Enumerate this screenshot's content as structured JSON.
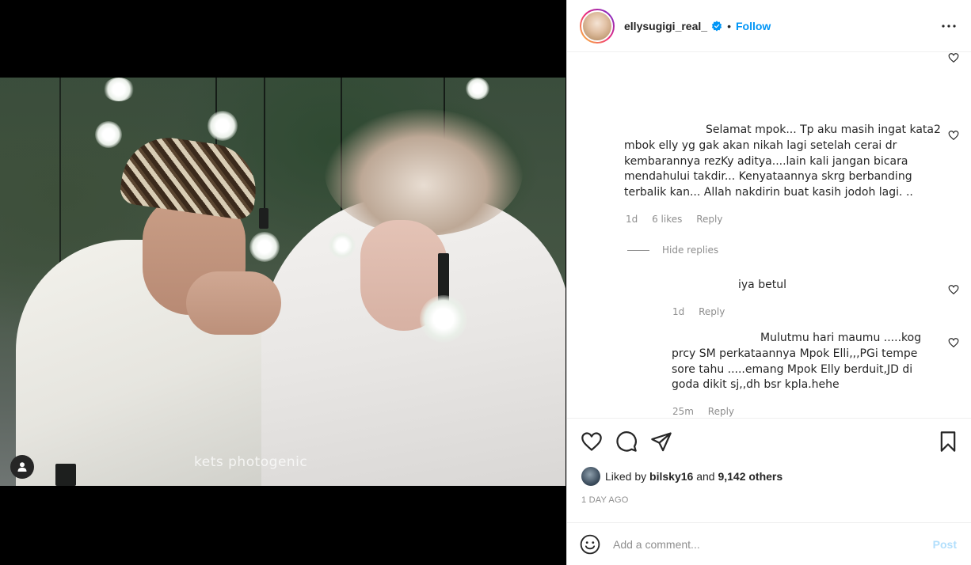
{
  "media": {
    "watermark": "kets photogenic",
    "tag_icon": "user-tag-icon"
  },
  "header": {
    "username": "ellysugigi_real_",
    "verified_icon": "verified-badge-icon",
    "separator": "•",
    "follow_label": "Follow",
    "more_icon": "more-options-icon"
  },
  "comments": [
    {
      "text_lines": [
        "Selamat mpok... Tp aku masih ingat kata2",
        "mbok elly yg gak akan nikah lagi setelah cerai dr",
        "kembarannya rezKy aditya....lain kali jangan bicara",
        "mendahului takdir... Kenyataannya skrg berbanding",
        "terbalik kan... Allah nakdirin buat kasih jodoh lagi. .."
      ],
      "time": "1d",
      "likes": "6 likes",
      "reply": "Reply",
      "hide_replies": "Hide replies"
    },
    {
      "text_lines": [
        "iya betul"
      ],
      "time": "1d",
      "reply": "Reply"
    },
    {
      "text_lines": [
        "Mulutmu hari maumu .....kog",
        "prcy SM perkataannya Mpok Elli,,,PGi tempe",
        "sore tahu .....emang Mpok Elly berduit,JD di",
        "goda dikit sj,,dh bsr kpla.hehe"
      ],
      "time": "25m",
      "reply": "Reply"
    }
  ],
  "actions": {
    "like_icon": "heart-icon",
    "comment_icon": "comment-bubble-icon",
    "share_icon": "paper-plane-icon",
    "save_icon": "bookmark-icon"
  },
  "likes": {
    "prefix": "Liked by",
    "user": "bilsky16",
    "and": "and",
    "others": "9,142 others"
  },
  "timestamp": "1 DAY AGO",
  "comment_box": {
    "placeholder": "Add a comment...",
    "post_label": "Post",
    "emoji_icon": "smiley-icon"
  },
  "colors": {
    "accent": "#0095f6",
    "post_disabled": "#b2dffc",
    "muted": "#8e8e8e"
  }
}
